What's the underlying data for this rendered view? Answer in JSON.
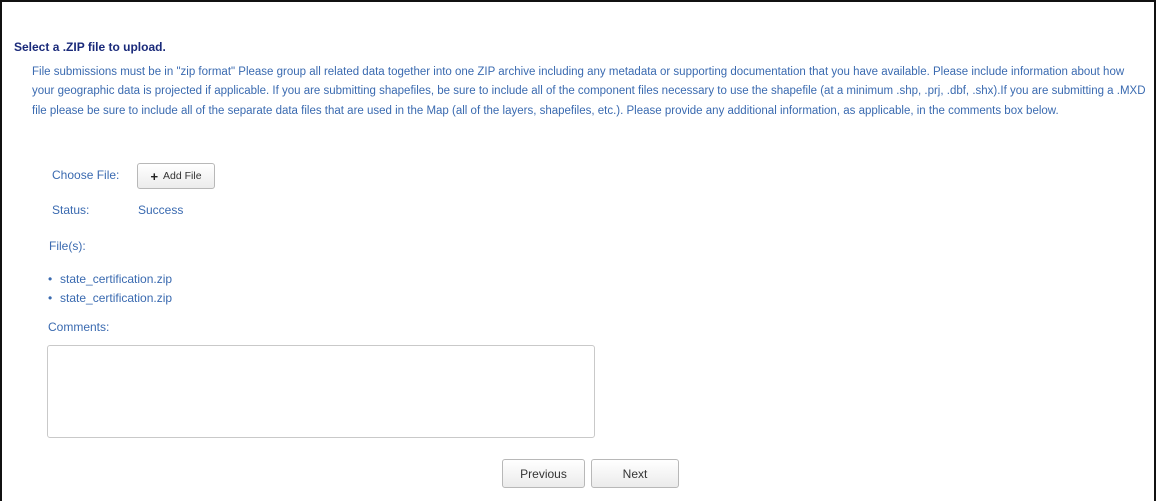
{
  "upload": {
    "heading": "Select a .ZIP file to upload.",
    "description": "File submissions must be in \"zip format\" Please group all related data together into one ZIP archive including any metadata or supporting documentation that you have available. Please include information about how your geographic data is projected if applicable. If you are submitting shapefiles, be sure to include all of the component files necessary to use the shapefile (at a minimum .shp, .prj, .dbf, .shx).If you are submitting a .MXD file please be sure to include all of the separate data files that are used in the Map (all of the layers, shapefiles, etc.). Please provide any additional information, as applicable, in the comments box below.",
    "choose_file_label": "Choose File:",
    "add_file_button": "Add File",
    "add_file_icon": "plus-icon",
    "status_label": "Status:",
    "status_value": "Success",
    "files_label": "File(s):",
    "files": [
      "state_certification.zip",
      "state_certification.zip"
    ],
    "comments_label": "Comments:",
    "comments_value": "",
    "comments_placeholder": ""
  },
  "nav": {
    "previous_label": "Previous",
    "next_label": "Next"
  },
  "colors": {
    "heading": "#1a2a7a",
    "text": "#3a6ab0"
  }
}
